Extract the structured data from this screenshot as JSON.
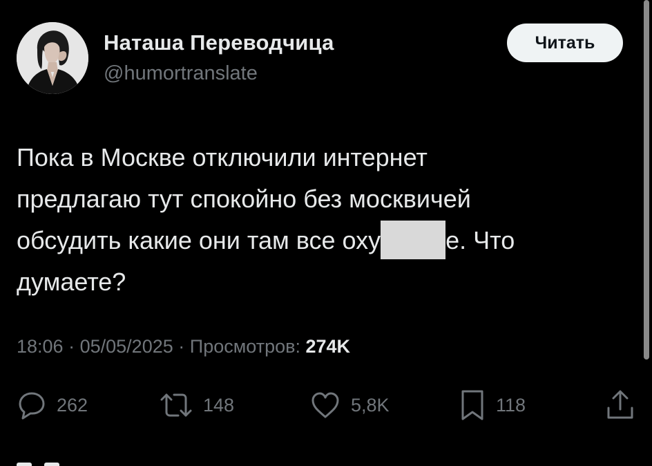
{
  "author": {
    "display_name": "Наташа Переводчица",
    "handle": "@humortranslate",
    "follow_label": "Читать"
  },
  "tweet": {
    "line1": "Пока в Москве отключили интернет",
    "line2": "предлагаю тут спокойно без москвичей",
    "line3_before": "обсудить какие они там все оху",
    "line3_after": "е. Что",
    "line4": "думаете?"
  },
  "meta": {
    "time": "18:06",
    "sep1": "·",
    "date": "05/05/2025",
    "sep2": "·",
    "views_label": "Просмотров:",
    "views_count": "274K"
  },
  "actions": {
    "replies": {
      "icon": "reply-icon",
      "count": "262"
    },
    "reposts": {
      "icon": "repost-icon",
      "count": "148"
    },
    "likes": {
      "icon": "heart-icon",
      "count": "5,8K"
    },
    "bookmarks": {
      "icon": "bookmark-icon",
      "count": "118"
    },
    "share": {
      "icon": "share-icon"
    }
  },
  "colors": {
    "background": "#000000",
    "text_primary": "#e7e9ea",
    "text_secondary": "#71767b",
    "button_bg": "#eff3f4",
    "button_text": "#0f1419",
    "redaction": "#d9d9d9"
  }
}
